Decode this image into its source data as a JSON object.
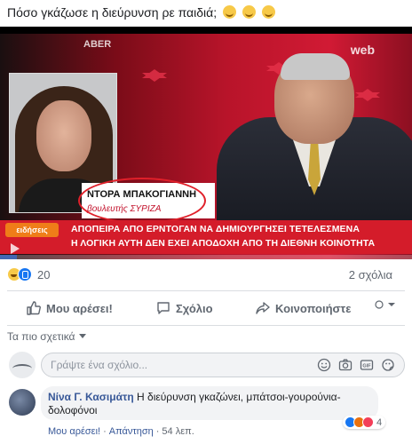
{
  "post": {
    "text": "Πόσο γκάζωσε η διεύρυνση ρε παιδιά;"
  },
  "video": {
    "channel_logo": "web",
    "corner_logo": "ABER",
    "top_ticker": "",
    "name_tag": {
      "name": "ΝΤΟΡΑ ΜΠΑΚΟΓΙΑΝΝΗ",
      "role": "βουλευτής ΣΥΡΙΖΑ",
      "mini_caption": ""
    },
    "ticker_badge": "ειδήσεις",
    "ticker_line_1": "ΑΠΟΠΕΙΡΑ ΑΠΟ ΕΡΝΤΟΓΑΝ ΝΑ ΔΗΜΙΟΥΡΓΗΣΕΙ ΤΕΤΕΛΕΣΜΕΝΑ",
    "ticker_line_2": "Η ΛΟΓΙΚΗ ΑΥΤΗ ΔΕΝ ΕΧΕΙ ΑΠΟΔΟΧΗ ΑΠΟ ΤΗ ΔΙΕΘΝΗ ΚΟΙΝΟΤΗΤΑ",
    "progress_fraction": 0.04
  },
  "stats": {
    "reactions_count": "20",
    "comments_label": "2 σχόλια"
  },
  "actions": {
    "like": "Μου αρέσει!",
    "comment": "Σχόλιο",
    "share": "Κοινοποιήστε"
  },
  "comments": {
    "sort_label": "Τα πιο σχετικά",
    "input_placeholder": "Γράψτε ένα σχόλιο...",
    "items": [
      {
        "author": "Νίνα Γ. Κασιμάτη",
        "text": "Η διεύρυνση γκαζώνει, μπάτσοι-γουρούνια-δολοφόνοι",
        "reactions": "4",
        "like_label": "Μου αρέσει!",
        "reply_label": "Απάντηση",
        "time": "54 λεπ."
      }
    ]
  },
  "colors": {
    "link": "#385898",
    "facebook_blue": "#1877f2",
    "ticker_red": "#d41c2a",
    "text_secondary": "#606770"
  }
}
